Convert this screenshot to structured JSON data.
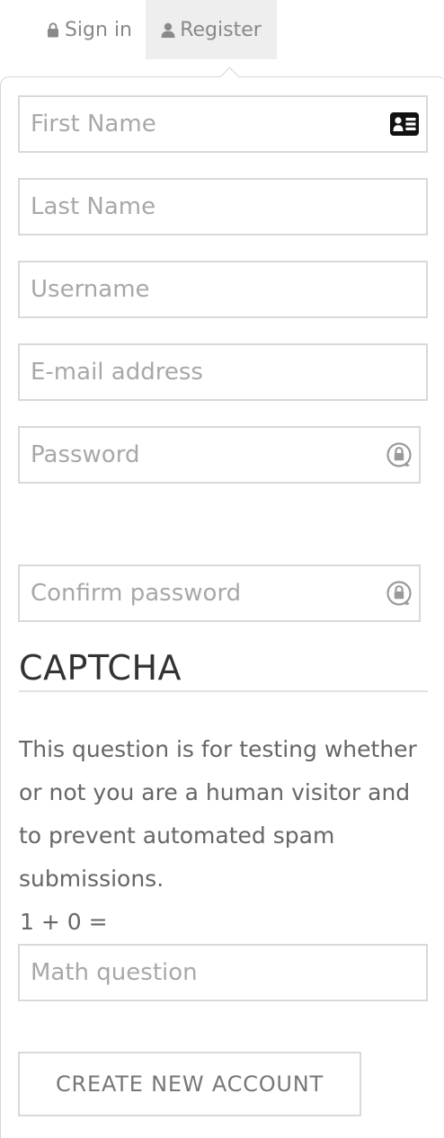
{
  "tabs": {
    "signin": {
      "label": "Sign in",
      "icon": "lock-icon"
    },
    "register": {
      "label": "Register",
      "icon": "user-icon",
      "active": true
    }
  },
  "form": {
    "first_name": {
      "placeholder": "First Name",
      "value": "",
      "icon": "id-card-icon"
    },
    "last_name": {
      "placeholder": "Last Name",
      "value": ""
    },
    "username": {
      "placeholder": "Username",
      "value": ""
    },
    "email": {
      "placeholder": "E-mail address",
      "value": ""
    },
    "password": {
      "placeholder": "Password",
      "value": "",
      "icon": "password-lock-icon"
    },
    "confirm_password": {
      "placeholder": "Confirm password",
      "value": "",
      "icon": "password-lock-icon"
    }
  },
  "captcha": {
    "title": "CAPTCHA",
    "description": "This question is for testing whether or not you are a human visitor and to prevent automated spam submissions.",
    "math_label": "1 + 0 =",
    "math_placeholder": "Math question",
    "math_value": ""
  },
  "submit": {
    "label": "CREATE NEW ACCOUNT"
  },
  "colors": {
    "border": "#d9d9d9",
    "active_tab_bg": "#eeeeee",
    "placeholder": "#a8a8a8",
    "heading": "#333333"
  }
}
